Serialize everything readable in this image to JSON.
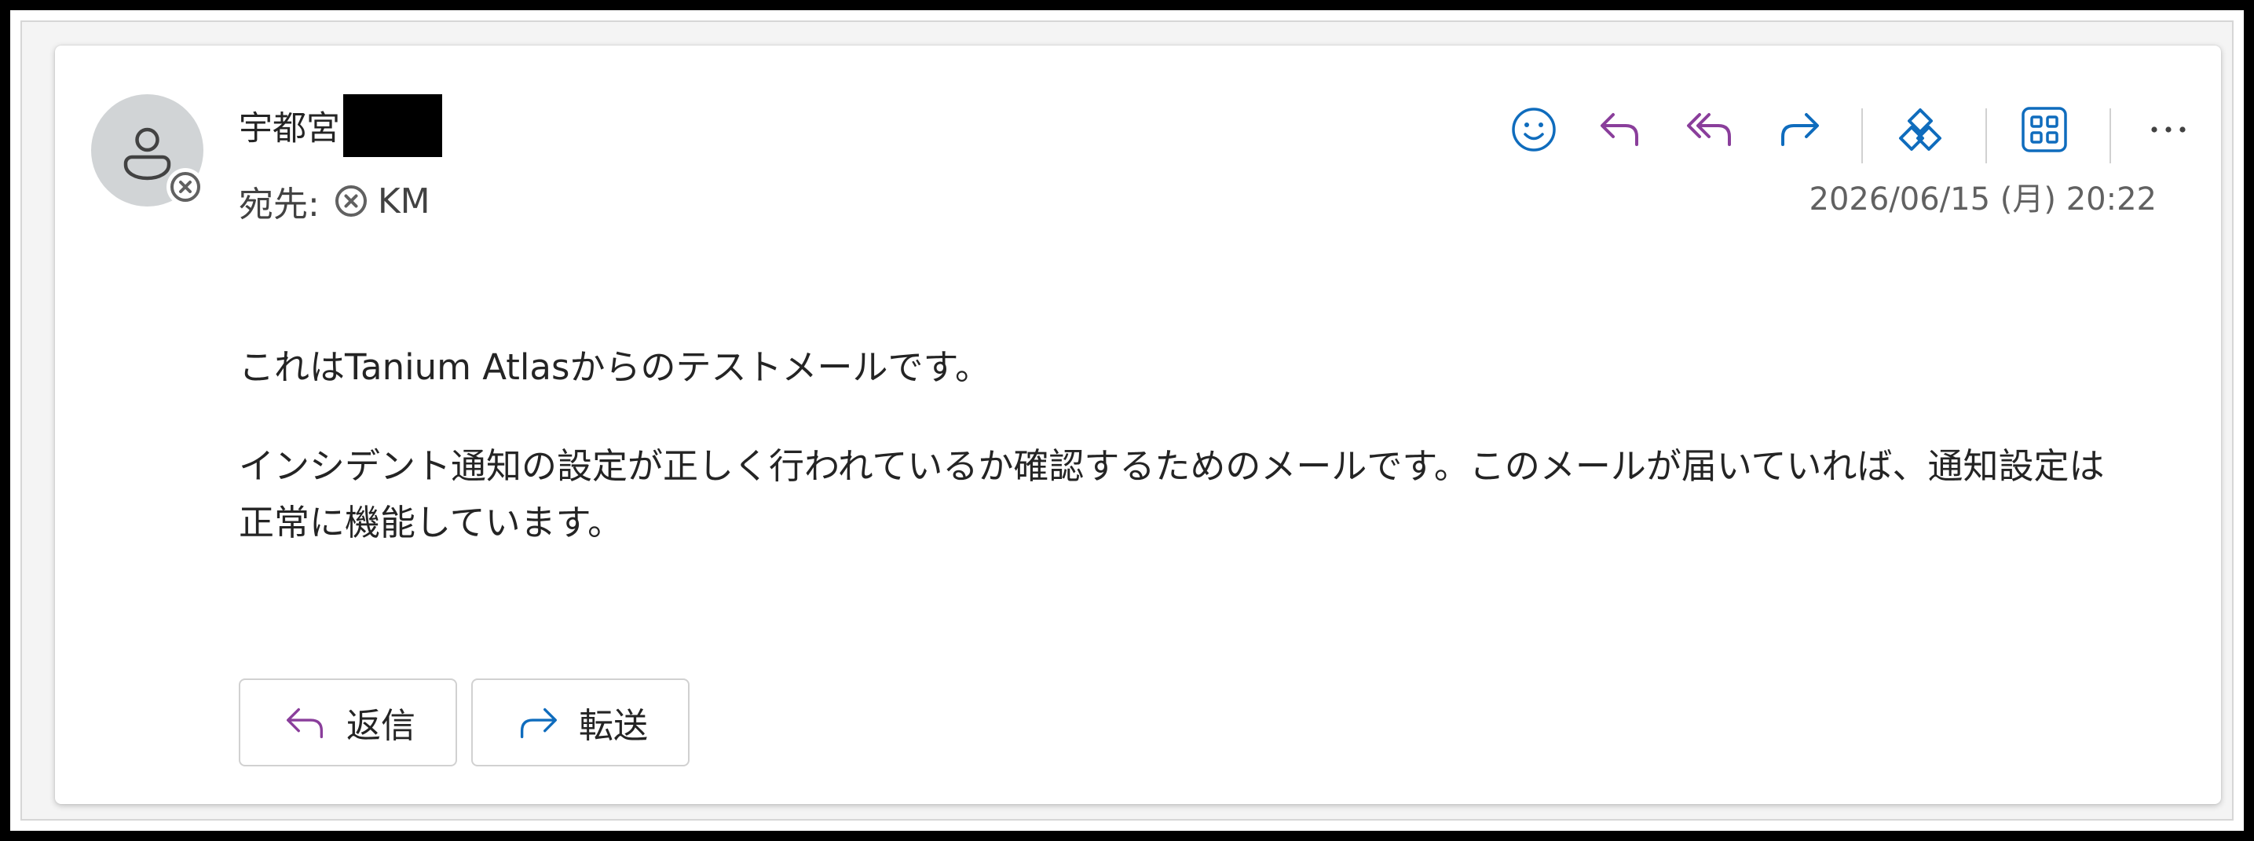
{
  "email": {
    "sender_name": "宇都宮",
    "to_label": "宛先:",
    "recipient": "KM",
    "datetime": "2026/06/15 (月) 20:22",
    "body": {
      "line1": "これはTanium Atlasからのテストメールです。",
      "line2": "インシデント通知の設定が正しく行われているか確認するためのメールです。このメールが届いていれば、通知設定は正常に機能しています。"
    }
  },
  "toolbar": {
    "icons": [
      "emoji-reaction-icon",
      "reply-icon",
      "reply-all-icon",
      "forward-icon",
      "copilot-icon",
      "apps-icon",
      "more-options-icon"
    ]
  },
  "actions": {
    "reply_label": "返信",
    "forward_label": "転送"
  },
  "colors": {
    "accent_blue": "#0f6cbd",
    "reply_purple": "#8a3e9b",
    "text_primary": "#242424",
    "text_secondary": "#616161"
  }
}
